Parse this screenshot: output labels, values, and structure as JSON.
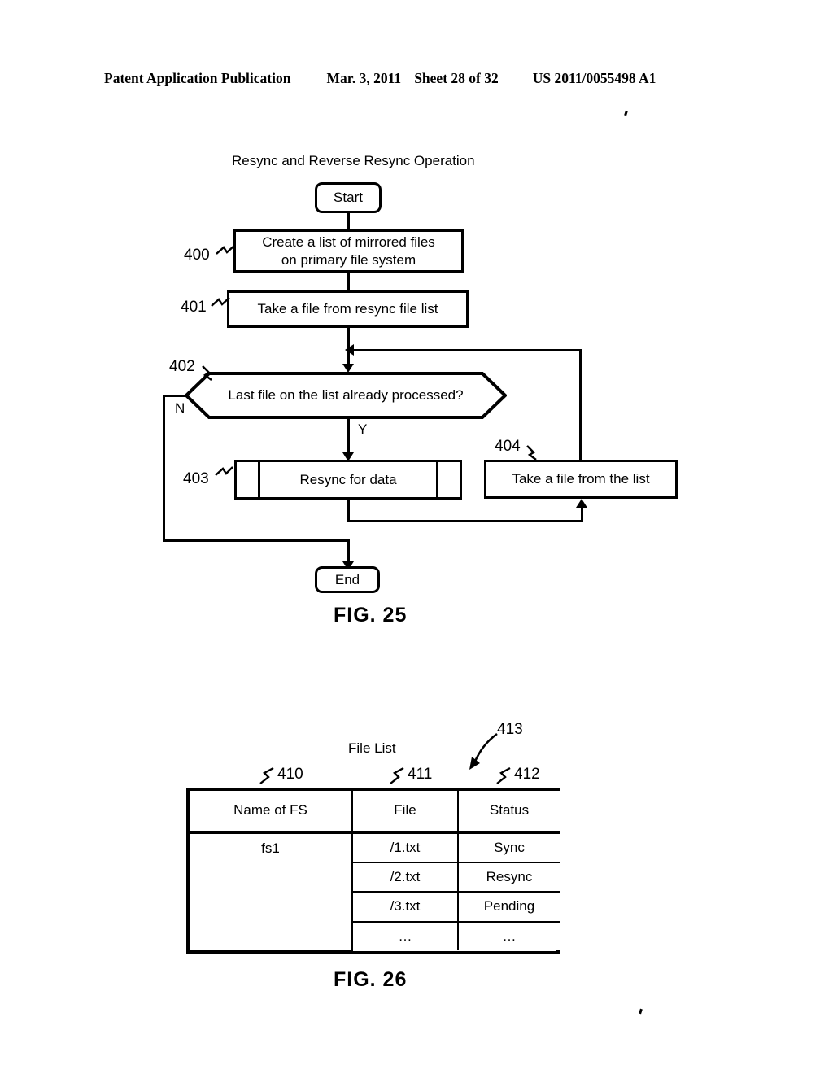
{
  "header": {
    "title": "Patent Application Publication",
    "date": "Mar. 3, 2011",
    "sheet": "Sheet 28 of 32",
    "patent_number": "US 2011/0055498 A1"
  },
  "figure25": {
    "caption": "FIG. 25",
    "title": "Resync and Reverse Resync Operation",
    "nodes": {
      "start": "Start",
      "end": "End",
      "step400": "Create a list of mirrored files on primary file system",
      "step400_line1": "Create a list of mirrored files",
      "step400_line2": "on primary file system",
      "step401": "Take a file from resync file list",
      "step402": "Last file on the list already processed?",
      "step403": "Resync for data",
      "step404": "Take a file from the list"
    },
    "ref_numbers": {
      "r400": "400",
      "r401": "401",
      "r402": "402",
      "r403": "403",
      "r404": "404"
    },
    "branch_labels": {
      "no": "N",
      "yes": "Y"
    }
  },
  "figure26": {
    "caption": "FIG. 26",
    "title": "File List",
    "ref_numbers": {
      "r410": "410",
      "r411": "411",
      "r412": "412",
      "r413": "413"
    },
    "table": {
      "columns": [
        "Name of FS",
        "File",
        "Status"
      ],
      "fs_name": "fs1",
      "rows": [
        {
          "file": "/1.txt",
          "status": "Sync"
        },
        {
          "file": "/2.txt",
          "status": "Resync"
        },
        {
          "file": "/3.txt",
          "status": "Pending"
        },
        {
          "file": "…",
          "status": "…"
        }
      ]
    }
  },
  "colors": {
    "ink": "#000000",
    "paper": "#ffffff"
  }
}
